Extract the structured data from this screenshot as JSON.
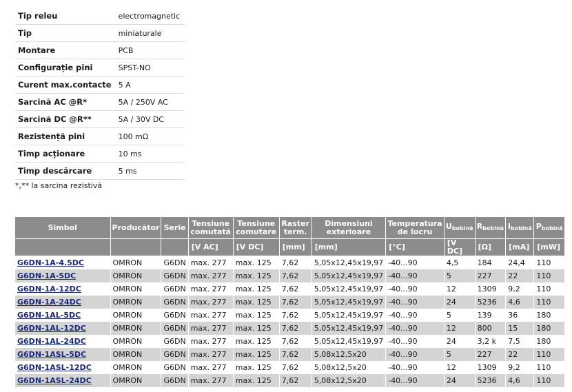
{
  "specs": [
    {
      "label": "Tip releu",
      "value": "electromagnetic"
    },
    {
      "label": "Tip",
      "value": "miniaturale"
    },
    {
      "label": "Montare",
      "value": "PCB"
    },
    {
      "label": "Configurație pini",
      "value": "SPST-NO"
    },
    {
      "label": "Curent max.contacte",
      "value": "5 A"
    },
    {
      "label": "Sarcină AC @R*",
      "value": "5A / 250V AC"
    },
    {
      "label": "Sarcină DC @R**",
      "value": "5A / 30V DC"
    },
    {
      "label": "Rezistență pini",
      "value": "100 mΩ"
    },
    {
      "label": "Timp acționare",
      "value": "10 ms"
    },
    {
      "label": "Timp descărcare",
      "value": "5 ms"
    }
  ],
  "note": "*,** la sarcina rezistivă",
  "table": {
    "headers": {
      "simbol": "Simbol",
      "producator": "Producător",
      "serie": "Serie",
      "tensiune_comutata": "Tensiune comutată",
      "tensiune_comutare": "Tensiune comutare",
      "raster": "Raster term.",
      "dimensiuni": "Dimensiuni exterioare",
      "temperatura": "Temperatura de lucru",
      "u_main": "U",
      "u_sub": "bobină",
      "r_main": "R",
      "r_sub": "bobină",
      "i_main": "I",
      "i_sub": "bobină",
      "p_main": "P",
      "p_sub": "bobină"
    },
    "units": [
      "",
      "",
      "",
      "[V AC]",
      "[V DC]",
      "[mm]",
      "[mm]",
      "[°C]",
      "[V DC]",
      "[Ω]",
      "[mA]",
      "[mW]"
    ],
    "rows": [
      [
        "G6DN-1A-4.5DC",
        "OMRON",
        "G6DN",
        "max. 277",
        "max. 125",
        "7,62",
        "5,05x12,45x19,97",
        "-40...90",
        "4,5",
        "184",
        "24,4",
        "110"
      ],
      [
        "G6DN-1A-5DC",
        "OMRON",
        "G6DN",
        "max. 277",
        "max. 125",
        "7,62",
        "5,05x12,45x19,97",
        "-40...90",
        "5",
        "227",
        "22",
        "110"
      ],
      [
        "G6DN-1A-12DC",
        "OMRON",
        "G6DN",
        "max. 277",
        "max. 125",
        "7,62",
        "5,05x12,45x19,97",
        "-40...90",
        "12",
        "1309",
        "9,2",
        "110"
      ],
      [
        "G6DN-1A-24DC",
        "OMRON",
        "G6DN",
        "max. 277",
        "max. 125",
        "7,62",
        "5,05x12,45x19,97",
        "-40...90",
        "24",
        "5236",
        "4,6",
        "110"
      ],
      [
        "G6DN-1AL-5DC",
        "OMRON",
        "G6DN",
        "max. 277",
        "max. 125",
        "7,62",
        "5,05x12,45x19,97",
        "-40...90",
        "5",
        "139",
        "36",
        "180"
      ],
      [
        "G6DN-1AL-12DC",
        "OMRON",
        "G6DN",
        "max. 277",
        "max. 125",
        "7,62",
        "5,05x12,45x19,97",
        "-40...90",
        "12",
        "800",
        "15",
        "180"
      ],
      [
        "G6DN-1AL-24DC",
        "OMRON",
        "G6DN",
        "max. 277",
        "max. 125",
        "7,62",
        "5,05x12,45x19,97",
        "-40...90",
        "24",
        "3,2 k",
        "7,5",
        "180"
      ],
      [
        "G6DN-1ASL-5DC",
        "OMRON",
        "G6DN",
        "max. 277",
        "max. 125",
        "7,62",
        "5,08x12,5x20",
        "-40...90",
        "5",
        "227",
        "22",
        "110"
      ],
      [
        "G6DN-1ASL-12DC",
        "OMRON",
        "G6DN",
        "max. 277",
        "max. 125",
        "7,62",
        "5,08x12,5x20",
        "-40...90",
        "12",
        "1309",
        "9,2",
        "110"
      ],
      [
        "G6DN-1ASL-24DC",
        "OMRON",
        "G6DN",
        "max. 277",
        "max. 125",
        "7,62",
        "5,08x12,5x20",
        "-40...90",
        "24",
        "5236",
        "4,6",
        "110"
      ]
    ]
  }
}
